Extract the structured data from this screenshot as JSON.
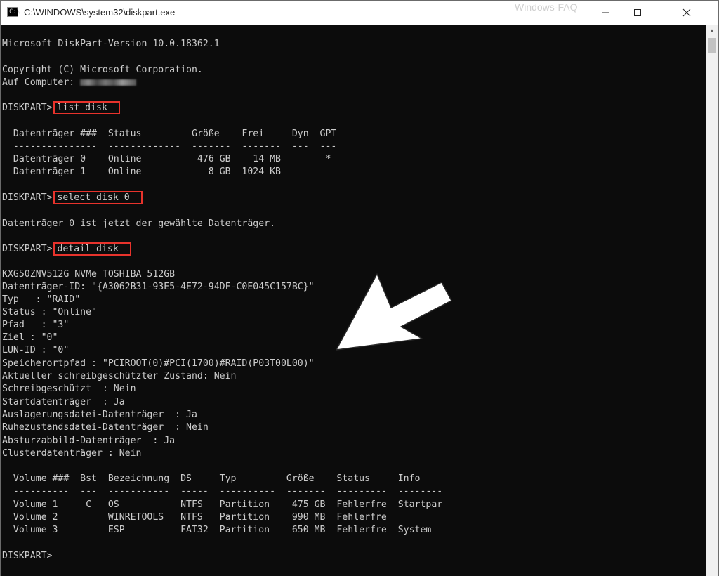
{
  "window": {
    "title": "C:\\WINDOWS\\system32\\diskpart.exe",
    "watermark": "Windows-FAQ",
    "icon_label": "C:\\"
  },
  "console": {
    "version_line": "Microsoft DiskPart-Version 10.0.18362.1",
    "copyright_line": "Copyright (C) Microsoft Corporation.",
    "computer_label": "Auf Computer: ",
    "prompt": "DISKPART>",
    "cmd1": "list disk",
    "disk_header": "  Datenträger ###  Status         Größe    Frei     Dyn  GPT",
    "disk_sep": "  ---------------  -------------  -------  -------  ---  ---",
    "disk_rows": [
      "  Datenträger 0    Online          476 GB    14 MB        *",
      "  Datenträger 1    Online            8 GB  1024 KB"
    ],
    "cmd2": "select disk 0",
    "select_result": "Datenträger 0 ist jetzt der gewählte Datenträger.",
    "cmd3": "detail disk",
    "detail_lines": [
      "KXG50ZNV512G NVMe TOSHIBA 512GB",
      "Datenträger-ID: \"{A3062B31-93E5-4E72-94DF-C0E045C157BC}\"",
      "Typ   : \"RAID\"",
      "Status : \"Online\"",
      "Pfad   : \"3\"",
      "Ziel : \"0\"",
      "LUN-ID : \"0\"",
      "Speicherortpfad : \"PCIROOT(0)#PCI(1700)#RAID(P03T00L00)\"",
      "Aktueller schreibgeschützter Zustand: Nein",
      "Schreibgeschützt  : Nein",
      "Startdatenträger  : Ja",
      "Auslagerungsdatei-Datenträger  : Ja",
      "Ruhezustandsdatei-Datenträger  : Nein",
      "Absturzabbild-Datenträger  : Ja",
      "Clusterdatenträger : Nein"
    ],
    "vol_header": "  Volume ###  Bst  Bezeichnung  DS     Typ         Größe    Status     Info",
    "vol_sep": "  ----------  ---  -----------  -----  ----------  -------  ---------  --------",
    "vol_rows": [
      "  Volume 1     C   OS           NTFS   Partition    475 GB  Fehlerfre  Startpar",
      "  Volume 2         WINRETOOLS   NTFS   Partition    990 MB  Fehlerfre",
      "  Volume 3         ESP          FAT32  Partition    650 MB  Fehlerfre  System"
    ]
  },
  "annotation": {
    "highlight_color": "#e8332c",
    "arrow_icon": "arrow-icon"
  }
}
